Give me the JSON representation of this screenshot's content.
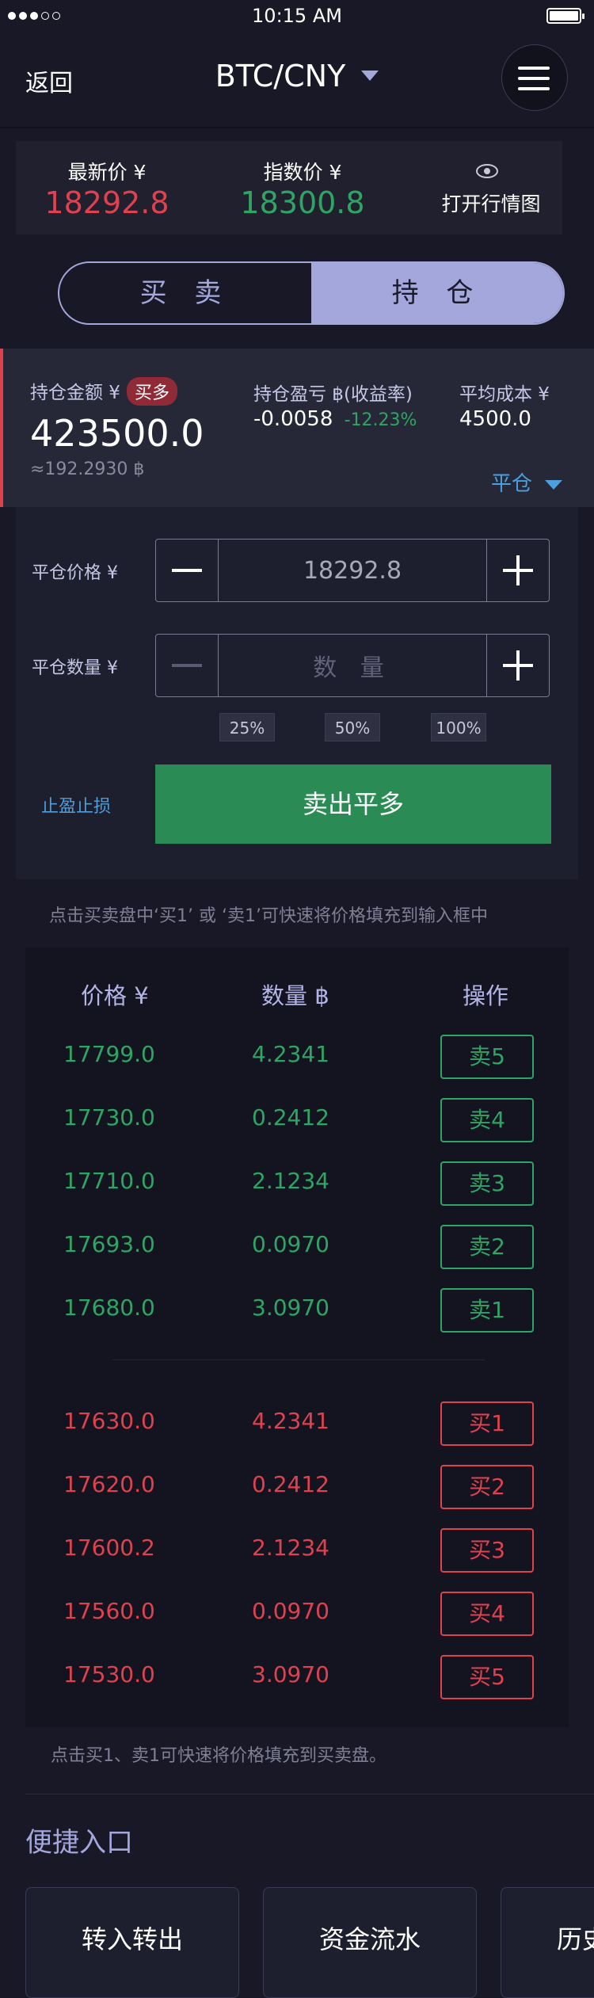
{
  "status_bar": {
    "time": "10:15 AM"
  },
  "nav": {
    "back_label": "返回",
    "pair": "BTC/CNY"
  },
  "prices": {
    "latest_label": "最新价 ¥",
    "latest_value": "18292.8",
    "index_label": "指数价 ¥",
    "index_value": "18300.8",
    "chart_label": "打开行情图"
  },
  "tabs": {
    "trade": "买 卖",
    "position": "持 仓"
  },
  "position": {
    "amount_label": "持仓金额 ¥",
    "badge": "买多",
    "amount_value": "423500.0",
    "amount_btc": "≈192.2930 ฿",
    "pnl_label": "持仓盈亏 ฿(收益率)",
    "pnl_value": "-0.0058",
    "pnl_rate": "-12.23%",
    "avg_cost_label": "平均成本 ¥",
    "avg_cost_value": "4500.0",
    "close_label": "平仓"
  },
  "form": {
    "price_label": "平仓价格 ¥",
    "price_value": "18292.8",
    "qty_label": "平仓数量 ¥",
    "qty_placeholder": "数 量",
    "pct_options": [
      "25%",
      "50%",
      "100%"
    ],
    "tp_sl_label": "止盈止损",
    "submit_label": "卖出平多"
  },
  "hint_top": "点击买卖盘中‘买1’ 或 ‘卖1’可快速将价格填充到输入框中",
  "order_book": {
    "headers": {
      "price": "价格 ¥",
      "qty": "数量 ฿",
      "action": "操作"
    },
    "asks": [
      {
        "price": "17799.0",
        "qty": "4.2341",
        "action": "卖5"
      },
      {
        "price": "17730.0",
        "qty": "0.2412",
        "action": "卖4"
      },
      {
        "price": "17710.0",
        "qty": "2.1234",
        "action": "卖3"
      },
      {
        "price": "17693.0",
        "qty": "0.0970",
        "action": "卖2"
      },
      {
        "price": "17680.0",
        "qty": "3.0970",
        "action": "卖1"
      }
    ],
    "bids": [
      {
        "price": "17630.0",
        "qty": "4.2341",
        "action": "买1"
      },
      {
        "price": "17620.0",
        "qty": "0.2412",
        "action": "买2"
      },
      {
        "price": "17600.2",
        "qty": "2.1234",
        "action": "买3"
      },
      {
        "price": "17560.0",
        "qty": "0.0970",
        "action": "买4"
      },
      {
        "price": "17530.0",
        "qty": "3.0970",
        "action": "买5"
      }
    ]
  },
  "hint_bottom": "点击买1、卖1可快速将价格填充到买卖盘。",
  "quick_entry": {
    "title": "便捷入口",
    "items": [
      "转入转出",
      "资金流水",
      "历史"
    ]
  },
  "colors": {
    "accent": "#a4a7db",
    "buy_green": "#2fa564",
    "sell_red": "#e0414f",
    "link_blue": "#4b9fdc"
  }
}
